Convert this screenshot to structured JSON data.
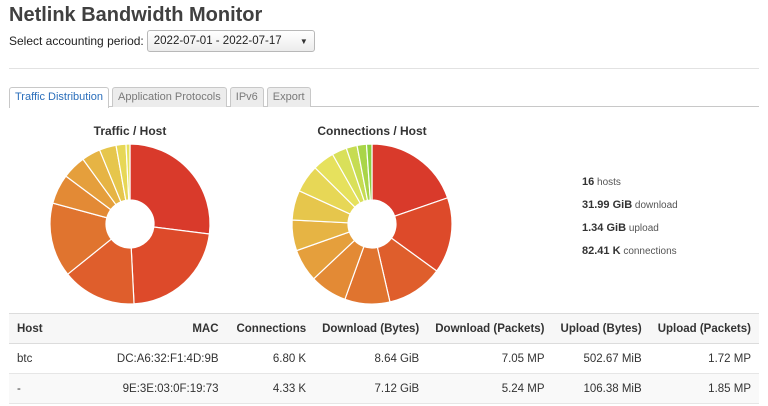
{
  "title": "Netlink Bandwidth Monitor",
  "period": {
    "label": "Select accounting period:",
    "value": "2022-07-01 - 2022-07-17"
  },
  "tabs": [
    {
      "label": "Traffic Distribution",
      "active": true
    },
    {
      "label": "Application Protocols",
      "active": false
    },
    {
      "label": "IPv6",
      "active": false
    },
    {
      "label": "Export",
      "active": false
    }
  ],
  "charts": {
    "traffic_title": "Traffic / Host",
    "connections_title": "Connections / Host"
  },
  "chart_data": [
    {
      "type": "pie",
      "title": "Traffic / Host",
      "slices": [
        {
          "value": 27.0,
          "color": "#d93a2b"
        },
        {
          "value": 22.2,
          "color": "#dd4a2a"
        },
        {
          "value": 15.0,
          "color": "#df5e2c"
        },
        {
          "value": 15.0,
          "color": "#e0742f"
        },
        {
          "value": 6.0,
          "color": "#e38a35"
        },
        {
          "value": 4.8,
          "color": "#e59f3c"
        },
        {
          "value": 3.8,
          "color": "#e6b444"
        },
        {
          "value": 3.4,
          "color": "#e6c64c"
        },
        {
          "value": 2.0,
          "color": "#e7d756"
        },
        {
          "value": 0.8,
          "color": "#e6e15d"
        }
      ]
    },
    {
      "type": "pie",
      "title": "Connections / Host",
      "slices": [
        {
          "value": 19.7,
          "color": "#d93a2b"
        },
        {
          "value": 15.3,
          "color": "#dd4a2a"
        },
        {
          "value": 11.4,
          "color": "#df5e2c"
        },
        {
          "value": 9.1,
          "color": "#e0742f"
        },
        {
          "value": 7.5,
          "color": "#e38a35"
        },
        {
          "value": 6.6,
          "color": "#e59f3c"
        },
        {
          "value": 6.2,
          "color": "#e6b444"
        },
        {
          "value": 6.0,
          "color": "#e6c64c"
        },
        {
          "value": 5.6,
          "color": "#e7d756"
        },
        {
          "value": 4.4,
          "color": "#e6e15d"
        },
        {
          "value": 3.0,
          "color": "#d9e05a"
        },
        {
          "value": 2.2,
          "color": "#c6dc52"
        },
        {
          "value": 1.9,
          "color": "#a9d548"
        },
        {
          "value": 1.1,
          "color": "#8ccf40"
        }
      ]
    }
  ],
  "stats": [
    {
      "value": "16",
      "unit": "hosts"
    },
    {
      "value": "31.99 GiB",
      "unit": "download"
    },
    {
      "value": "1.34 GiB",
      "unit": "upload"
    },
    {
      "value": "82.41 K",
      "unit": "connections"
    }
  ],
  "table": {
    "headers": {
      "host": "Host",
      "mac": "MAC",
      "connections": "Connections",
      "download_bytes": "Download (Bytes)",
      "download_packets": "Download (Packets)",
      "upload_bytes": "Upload (Bytes)",
      "upload_packets": "Upload (Packets)"
    },
    "rows": [
      {
        "host": "btc",
        "mac": "DC:A6:32:F1:4D:9B",
        "connections": "6.80 K",
        "download_bytes": "8.64 GiB",
        "download_packets": "7.05 MP",
        "upload_bytes": "502.67 MiB",
        "upload_packets": "1.72 MP"
      },
      {
        "host": "-",
        "mac": "9E:3E:03:0F:19:73",
        "connections": "4.33 K",
        "download_bytes": "7.12 GiB",
        "download_packets": "5.24 MP",
        "upload_bytes": "106.38 MiB",
        "upload_packets": "1.85 MP"
      }
    ]
  }
}
